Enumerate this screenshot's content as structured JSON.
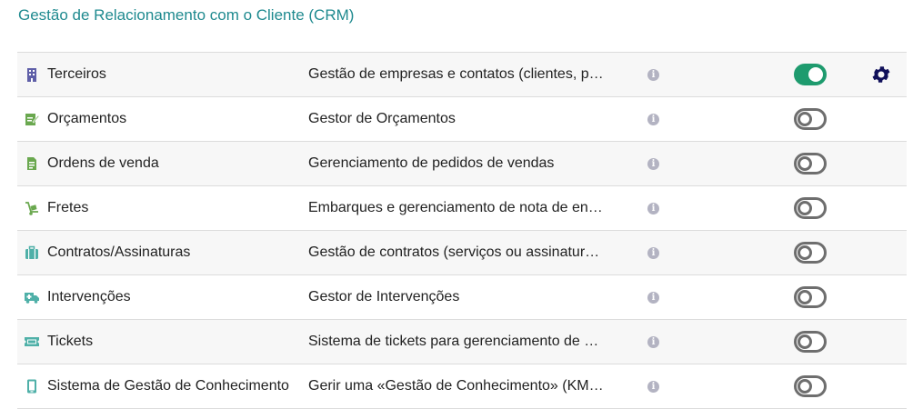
{
  "section": {
    "title": "Gestão de Relacionamento com o Cliente (CRM)"
  },
  "colors": {
    "accent": "#1f8a8f",
    "toggle_on": "#1e9b6e",
    "toggle_off": "#6e6e6e",
    "gear": "#10105a"
  },
  "modules": [
    {
      "name": "Terceiros",
      "description": "Gestão de empresas e contatos (clientes, p…",
      "icon": "building-icon",
      "enabled": true,
      "has_settings": true
    },
    {
      "name": "Orçamentos",
      "description": "Gestor de Orçamentos",
      "icon": "proposal-edit-icon",
      "enabled": false,
      "has_settings": false
    },
    {
      "name": "Ordens de venda",
      "description": "Gerenciamento de pedidos de vendas",
      "icon": "document-icon",
      "enabled": false,
      "has_settings": false
    },
    {
      "name": "Fretes",
      "description": "Embarques e gerenciamento de nota de en…",
      "icon": "dolly-icon",
      "enabled": false,
      "has_settings": false
    },
    {
      "name": "Contratos/Assinaturas",
      "description": "Gestão de contratos (serviços ou assinatur…",
      "icon": "suitcase-icon",
      "enabled": false,
      "has_settings": false
    },
    {
      "name": "Intervenções",
      "description": "Gestor de Intervenções",
      "icon": "ambulance-icon",
      "enabled": false,
      "has_settings": false
    },
    {
      "name": "Tickets",
      "description": "Sistema de tickets para gerenciamento de …",
      "icon": "ticket-icon",
      "enabled": false,
      "has_settings": false
    },
    {
      "name": "Sistema de Gestão de Conhecimento",
      "description": "Gerir uma «Gestão de Conhecimento» (KM…",
      "icon": "mobile-icon",
      "enabled": false,
      "has_settings": false
    }
  ]
}
